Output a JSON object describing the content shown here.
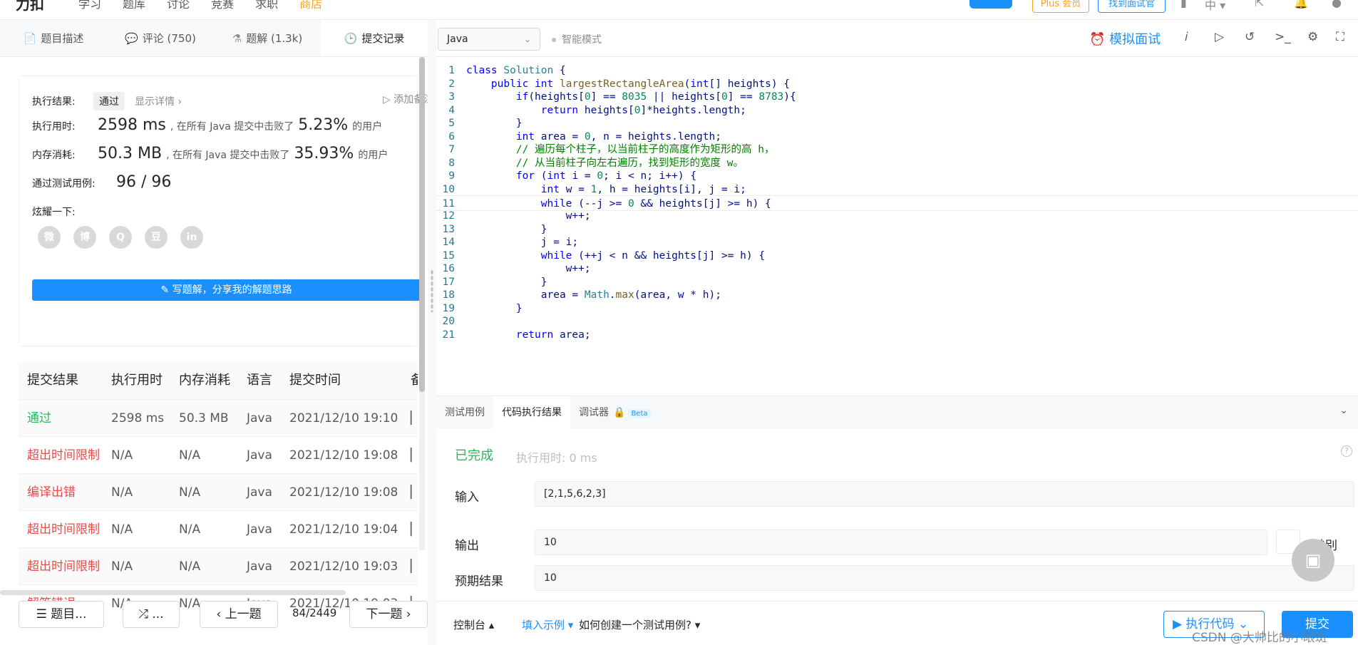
{
  "topbar": {
    "logo": "力扣",
    "nav": [
      "学习",
      "题库",
      "讨论",
      "竞赛",
      "求职",
      "商店"
    ],
    "plus": "Plus 会员",
    "interview": "找到面试官"
  },
  "tabs": [
    {
      "label": "题目描述",
      "icon": "📄"
    },
    {
      "label": "评论 (750)",
      "icon": "💬"
    },
    {
      "label": "题解 (1.3k)",
      "icon": "⚗"
    },
    {
      "label": "提交记录",
      "icon": "🕒"
    }
  ],
  "summary": {
    "result_label": "执行结果:",
    "result_value": "通过",
    "detail_link": "显示详情 ›",
    "add_note": "添加备注",
    "time_label": "执行用时:",
    "time_value": "2598 ms",
    "time_mid": ", 在所有 Java 提交中击败了",
    "time_pct": "5.23%",
    "users": "的用户",
    "mem_label": "内存消耗:",
    "mem_value": "50.3 MB",
    "mem_mid": ", 在所有 Java 提交中击败了",
    "mem_pct": "35.93%",
    "cases_label": "通过测试用例:",
    "cases_value": "96 / 96",
    "share_label": "炫耀一下:",
    "share_icons": [
      "微",
      "博",
      "Q",
      "豆",
      "in"
    ],
    "solution_btn": "✎ 写题解，分享我的解题思路"
  },
  "table": {
    "headers": [
      "提交结果",
      "执行用时",
      "内存消耗",
      "语言",
      "提交时间",
      "备"
    ],
    "rows": [
      {
        "status": "通过",
        "time": "2598 ms",
        "mem": "50.3 MB",
        "lang": "Java",
        "at": "2021/12/10 19:10",
        "ok": true
      },
      {
        "status": "超出时间限制",
        "time": "N/A",
        "mem": "N/A",
        "lang": "Java",
        "at": "2021/12/10 19:08",
        "ok": false
      },
      {
        "status": "编译出错",
        "time": "N/A",
        "mem": "N/A",
        "lang": "Java",
        "at": "2021/12/10 19:08",
        "ok": false
      },
      {
        "status": "超出时间限制",
        "time": "N/A",
        "mem": "N/A",
        "lang": "Java",
        "at": "2021/12/10 19:04",
        "ok": false
      },
      {
        "status": "超出时间限制",
        "time": "N/A",
        "mem": "N/A",
        "lang": "Java",
        "at": "2021/12/10 19:03",
        "ok": false
      },
      {
        "status": "解答错误",
        "time": "N/A",
        "mem": "N/A",
        "lang": "Java",
        "at": "2021/12/10 19:03",
        "ok": false
      }
    ]
  },
  "pager": {
    "list_btn": "题目...",
    "random_btn": "...",
    "prev_btn": "上一题",
    "position": "84/2449",
    "next_btn": "下一题"
  },
  "editor": {
    "language": "Java",
    "smart_mode": "智能模式",
    "mock_interview": "模拟面试",
    "current_line": 11,
    "lines": [
      "class Solution {",
      "    public int largestRectangleArea(int[] heights) {",
      "        if(heights[0] == 8035 || heights[0] == 8783){",
      "            return heights[0]*heights.length;",
      "        }",
      "        int area = 0, n = heights.length;",
      "        // 遍历每个柱子，以当前柱子的高度作为矩形的高 h，",
      "        // 从当前柱子向左右遍历，找到矩形的宽度 w。",
      "        for (int i = 0; i < n; i++) {",
      "            int w = 1, h = heights[i], j = i;",
      "            while (--j >= 0 && heights[j] >= h) {",
      "                w++;",
      "            }",
      "            j = i;",
      "            while (++j < n && heights[j] >= h) {",
      "                w++;",
      "            }",
      "            area = Math.max(area, w * h);",
      "        }",
      "",
      "        return area;"
    ]
  },
  "bottom_tabs": [
    "测试用例",
    "代码执行结果",
    "调试器"
  ],
  "beta": "Beta",
  "result": {
    "status": "已完成",
    "exec_time": "执行用时: 0 ms",
    "input_label": "输入",
    "input_value": "[2,1,5,6,2,3]",
    "output_label": "输出",
    "output_value": "10",
    "expected_label": "预期结果",
    "expected_value": "10",
    "diff_label": "差别"
  },
  "footer": {
    "console": "控制台",
    "fill_example": "填入示例",
    "how_to": "如何创建一个测试用例?",
    "run": "执行代码",
    "submit": "提交",
    "watermark": "CSDN @大帅比的小眼斑"
  }
}
